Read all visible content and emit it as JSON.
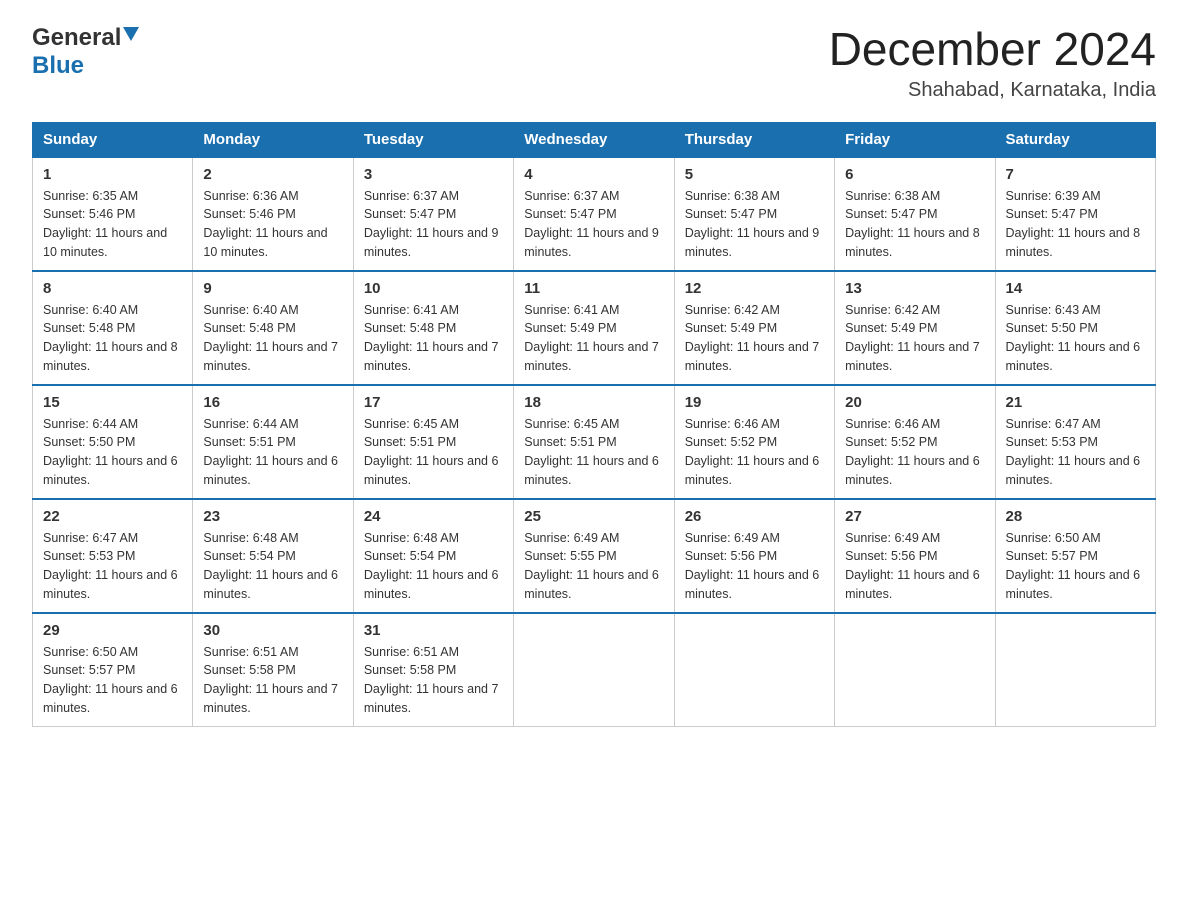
{
  "logo": {
    "general": "General",
    "blue": "Blue"
  },
  "title": "December 2024",
  "subtitle": "Shahabad, Karnataka, India",
  "days_of_week": [
    "Sunday",
    "Monday",
    "Tuesday",
    "Wednesday",
    "Thursday",
    "Friday",
    "Saturday"
  ],
  "weeks": [
    [
      {
        "day": "1",
        "sunrise": "6:35 AM",
        "sunset": "5:46 PM",
        "daylight": "11 hours and 10 minutes."
      },
      {
        "day": "2",
        "sunrise": "6:36 AM",
        "sunset": "5:46 PM",
        "daylight": "11 hours and 10 minutes."
      },
      {
        "day": "3",
        "sunrise": "6:37 AM",
        "sunset": "5:47 PM",
        "daylight": "11 hours and 9 minutes."
      },
      {
        "day": "4",
        "sunrise": "6:37 AM",
        "sunset": "5:47 PM",
        "daylight": "11 hours and 9 minutes."
      },
      {
        "day": "5",
        "sunrise": "6:38 AM",
        "sunset": "5:47 PM",
        "daylight": "11 hours and 9 minutes."
      },
      {
        "day": "6",
        "sunrise": "6:38 AM",
        "sunset": "5:47 PM",
        "daylight": "11 hours and 8 minutes."
      },
      {
        "day": "7",
        "sunrise": "6:39 AM",
        "sunset": "5:47 PM",
        "daylight": "11 hours and 8 minutes."
      }
    ],
    [
      {
        "day": "8",
        "sunrise": "6:40 AM",
        "sunset": "5:48 PM",
        "daylight": "11 hours and 8 minutes."
      },
      {
        "day": "9",
        "sunrise": "6:40 AM",
        "sunset": "5:48 PM",
        "daylight": "11 hours and 7 minutes."
      },
      {
        "day": "10",
        "sunrise": "6:41 AM",
        "sunset": "5:48 PM",
        "daylight": "11 hours and 7 minutes."
      },
      {
        "day": "11",
        "sunrise": "6:41 AM",
        "sunset": "5:49 PM",
        "daylight": "11 hours and 7 minutes."
      },
      {
        "day": "12",
        "sunrise": "6:42 AM",
        "sunset": "5:49 PM",
        "daylight": "11 hours and 7 minutes."
      },
      {
        "day": "13",
        "sunrise": "6:42 AM",
        "sunset": "5:49 PM",
        "daylight": "11 hours and 7 minutes."
      },
      {
        "day": "14",
        "sunrise": "6:43 AM",
        "sunset": "5:50 PM",
        "daylight": "11 hours and 6 minutes."
      }
    ],
    [
      {
        "day": "15",
        "sunrise": "6:44 AM",
        "sunset": "5:50 PM",
        "daylight": "11 hours and 6 minutes."
      },
      {
        "day": "16",
        "sunrise": "6:44 AM",
        "sunset": "5:51 PM",
        "daylight": "11 hours and 6 minutes."
      },
      {
        "day": "17",
        "sunrise": "6:45 AM",
        "sunset": "5:51 PM",
        "daylight": "11 hours and 6 minutes."
      },
      {
        "day": "18",
        "sunrise": "6:45 AM",
        "sunset": "5:51 PM",
        "daylight": "11 hours and 6 minutes."
      },
      {
        "day": "19",
        "sunrise": "6:46 AM",
        "sunset": "5:52 PM",
        "daylight": "11 hours and 6 minutes."
      },
      {
        "day": "20",
        "sunrise": "6:46 AM",
        "sunset": "5:52 PM",
        "daylight": "11 hours and 6 minutes."
      },
      {
        "day": "21",
        "sunrise": "6:47 AM",
        "sunset": "5:53 PM",
        "daylight": "11 hours and 6 minutes."
      }
    ],
    [
      {
        "day": "22",
        "sunrise": "6:47 AM",
        "sunset": "5:53 PM",
        "daylight": "11 hours and 6 minutes."
      },
      {
        "day": "23",
        "sunrise": "6:48 AM",
        "sunset": "5:54 PM",
        "daylight": "11 hours and 6 minutes."
      },
      {
        "day": "24",
        "sunrise": "6:48 AM",
        "sunset": "5:54 PM",
        "daylight": "11 hours and 6 minutes."
      },
      {
        "day": "25",
        "sunrise": "6:49 AM",
        "sunset": "5:55 PM",
        "daylight": "11 hours and 6 minutes."
      },
      {
        "day": "26",
        "sunrise": "6:49 AM",
        "sunset": "5:56 PM",
        "daylight": "11 hours and 6 minutes."
      },
      {
        "day": "27",
        "sunrise": "6:49 AM",
        "sunset": "5:56 PM",
        "daylight": "11 hours and 6 minutes."
      },
      {
        "day": "28",
        "sunrise": "6:50 AM",
        "sunset": "5:57 PM",
        "daylight": "11 hours and 6 minutes."
      }
    ],
    [
      {
        "day": "29",
        "sunrise": "6:50 AM",
        "sunset": "5:57 PM",
        "daylight": "11 hours and 6 minutes."
      },
      {
        "day": "30",
        "sunrise": "6:51 AM",
        "sunset": "5:58 PM",
        "daylight": "11 hours and 7 minutes."
      },
      {
        "day": "31",
        "sunrise": "6:51 AM",
        "sunset": "5:58 PM",
        "daylight": "11 hours and 7 minutes."
      },
      null,
      null,
      null,
      null
    ]
  ]
}
